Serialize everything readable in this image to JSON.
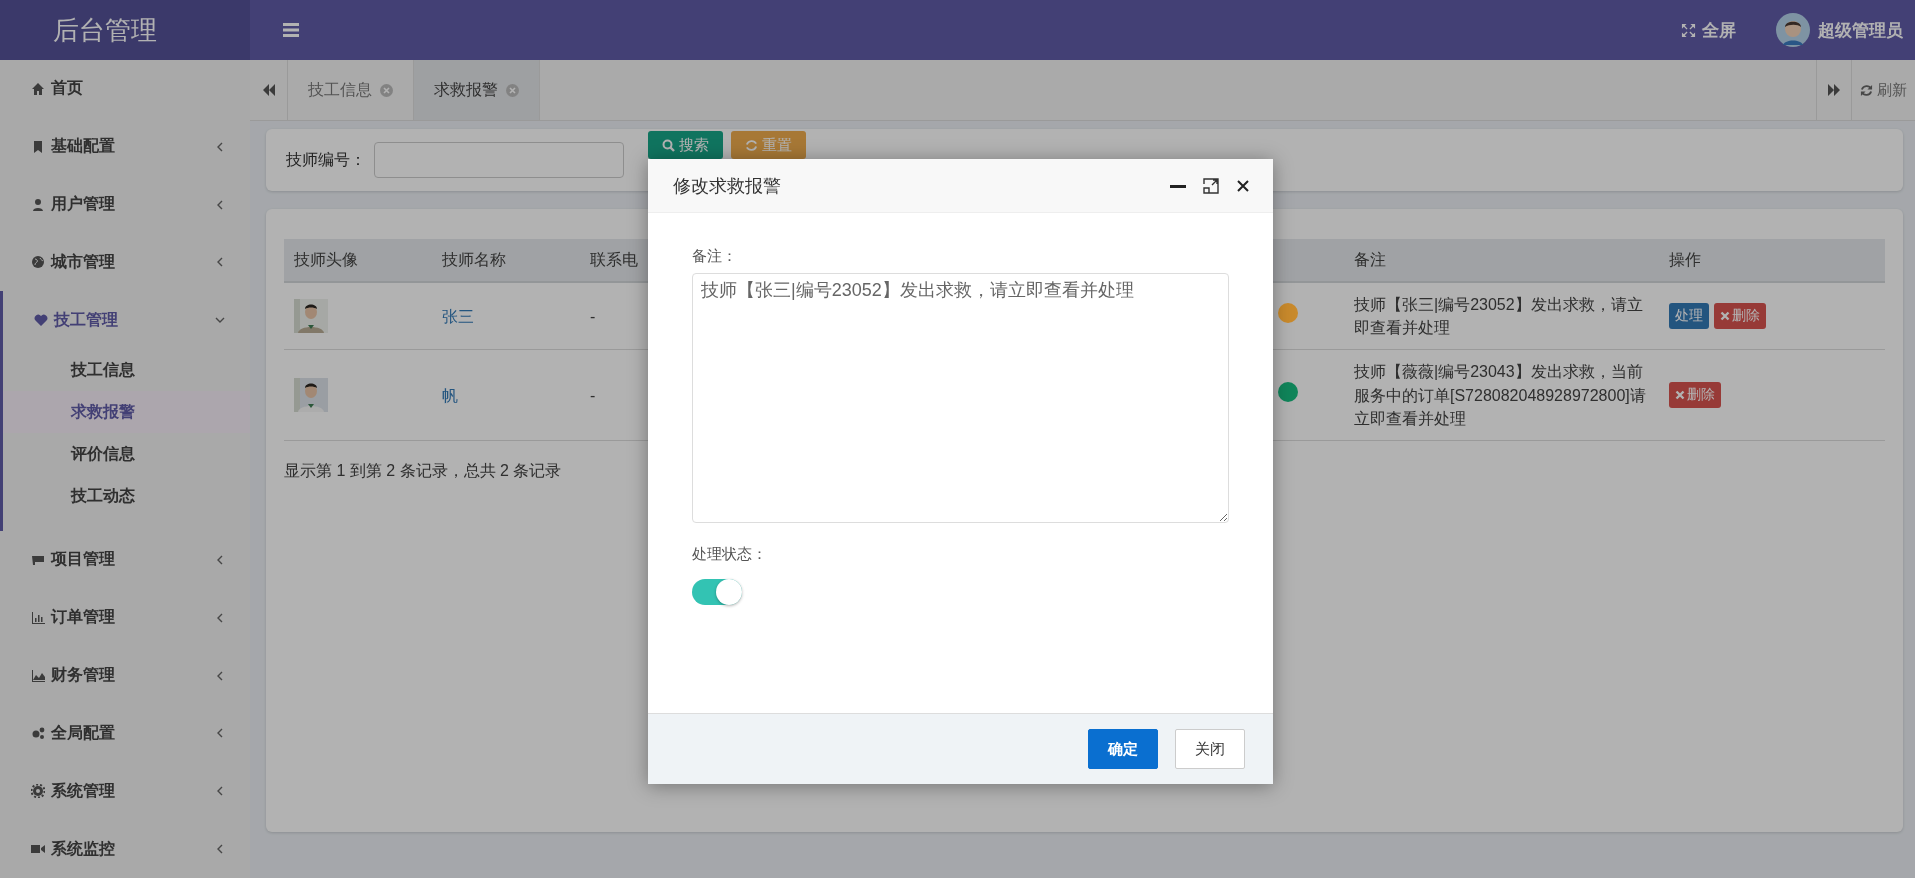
{
  "app_title": "后台管理",
  "topbar": {
    "fullscreen": "全屏",
    "user": "超级管理员"
  },
  "sidebar": {
    "items": [
      {
        "label": "首页"
      },
      {
        "label": "基础配置",
        "expanded": false
      },
      {
        "label": "用户管理",
        "expanded": false
      },
      {
        "label": "城市管理",
        "expanded": false
      },
      {
        "label": "技工管理",
        "expanded": true,
        "children": [
          {
            "label": "技工信息",
            "selected": false
          },
          {
            "label": "求救报警",
            "selected": true
          },
          {
            "label": "评价信息",
            "selected": false
          },
          {
            "label": "技工动态",
            "selected": false
          }
        ]
      },
      {
        "label": "项目管理",
        "expanded": false
      },
      {
        "label": "订单管理",
        "expanded": false
      },
      {
        "label": "财务管理",
        "expanded": false
      },
      {
        "label": "全局配置",
        "expanded": false
      },
      {
        "label": "系统管理",
        "expanded": false
      },
      {
        "label": "系统监控",
        "expanded": false
      }
    ]
  },
  "tabs": [
    {
      "label": "技工信息",
      "selected": false
    },
    {
      "label": "求救报警",
      "selected": true
    }
  ],
  "refresh": "刷新",
  "search": {
    "label": "技师编号：",
    "buttons": [
      {
        "label": "搜索",
        "kind": "search"
      },
      {
        "label": "重置",
        "kind": "reset"
      }
    ]
  },
  "table": {
    "columns": [
      "技师头像",
      "技师名称",
      "联系电",
      "备注",
      "操作"
    ],
    "rows": [
      {
        "avatar": {
          "kind": "picture"
        },
        "name": "张三",
        "phone": "-",
        "color": "#c98a2c",
        "note": "技师【张三|编号23052】发出求救，请立即查看并处理",
        "actions": [
          {
            "label": "处理",
            "kind": "process"
          },
          {
            "label": "删除",
            "kind": "delete"
          }
        ]
      },
      {
        "avatar": {
          "kind": "picture"
        },
        "name": "帆",
        "phone": "-",
        "color": "#10855a",
        "note": "技师【薇薇|编号23043】发出求救，当前服务中的订单[S728082048928972800]请立即查看并处理",
        "actions": [
          {
            "label": "删除",
            "kind": "delete"
          }
        ]
      }
    ]
  },
  "pagination_info": "显示第 1 到第 2 条记录，总共 2 条记录",
  "dialog": {
    "title": "修改求救报警",
    "fields": [
      {
        "kind": "textarea",
        "label": "备注：",
        "value": "技师【张三|编号23052】发出求救，请立即查看并处理"
      },
      {
        "kind": "switch",
        "label": "处理状态：",
        "on": true
      }
    ],
    "buttons": [
      {
        "label": "确定",
        "kind": "primary"
      },
      {
        "label": "关闭",
        "kind": "default"
      }
    ]
  }
}
